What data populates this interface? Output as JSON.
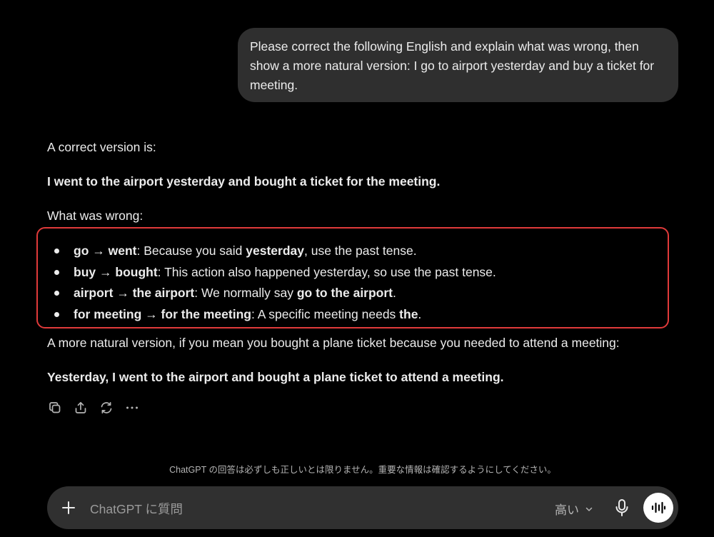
{
  "user_message": {
    "text": "Please correct the following English and explain what was wrong, then show a more natural version: I go to airport yesterday and buy a ticket for meeting."
  },
  "answer": {
    "intro": "A correct version is:",
    "corrected": "I went to the airport yesterday and bought a ticket for the meeting.",
    "wrong_heading": "What was wrong:",
    "bullets": [
      {
        "from": "go",
        "arrow": "→",
        "to": "went",
        "sep": ":",
        "text_a": " Because you said ",
        "bold_a": "yesterday",
        "text_b": ", use the past tense."
      },
      {
        "from": "buy",
        "arrow": "→",
        "to": "bought",
        "sep": ":",
        "text_a": " This action also happened yesterday, so use the past tense.",
        "bold_a": "",
        "text_b": ""
      },
      {
        "from": "airport",
        "arrow": "→",
        "to": "the airport",
        "sep": ":",
        "text_a": " We normally say ",
        "bold_a": "go to the airport",
        "text_b": "."
      },
      {
        "from": "for meeting",
        "arrow": "→",
        "to": "for the meeting",
        "sep": ":",
        "text_a": " A specific meeting needs ",
        "bold_a": "the",
        "text_b": "."
      }
    ],
    "natural_intro": "A more natural version, if you mean you bought a plane ticket because you needed to attend a meeting:",
    "natural": "Yesterday, I went to the airport and bought a plane ticket to attend a meeting."
  },
  "highlight_color": "#e03a3a",
  "actions": [
    {
      "icon": "copy-icon"
    },
    {
      "icon": "share-icon"
    },
    {
      "icon": "regenerate-icon"
    },
    {
      "icon": "more-icon"
    }
  ],
  "disclaimer": "ChatGPT の回答は必ずしも正しいとは限りません。重要な情報は確認するようにしてください。",
  "composer": {
    "placeholder": "ChatGPT に質問",
    "model": "高い",
    "plus_icon": "plus-icon",
    "mic_icon": "mic-icon",
    "voice_icon": "voice-mode-icon"
  }
}
